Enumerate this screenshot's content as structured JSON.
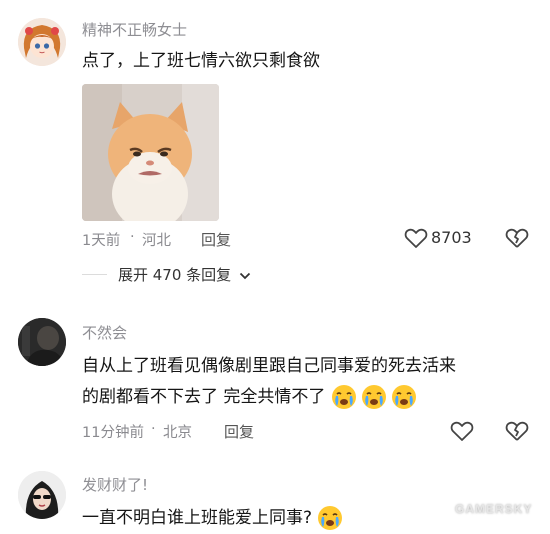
{
  "comments": [
    {
      "username": "精神不正畅女士",
      "text": "点了，上了班七情六欲只剩食欲",
      "time": "1天前",
      "location": "河北",
      "reply_label": "回复",
      "likes": "8703",
      "expand_label": "展开 470 条回复",
      "avatar_icon": "anime-girl-avatar",
      "image_icon": "sad-cat-meme"
    },
    {
      "username": "不然会",
      "text_line1": "自从上了班看见偶像剧里跟自己同事爱的死去活来",
      "text_line2": "的剧都看不下去了 完全共情不了",
      "time": "11分钟前",
      "location": "北京",
      "reply_label": "回复",
      "avatar_icon": "dark-photo-avatar",
      "emoji_icon": "crying-face-emoji"
    },
    {
      "username": "发财财了!",
      "text": "一直不明白谁上班能爱上同事?",
      "avatar_icon": "woman-sunglasses-avatar",
      "emoji_icon": "crying-face-emoji"
    }
  ],
  "watermark": "GAMERSKY",
  "colors": {
    "meta_gray": "#8a8a8f",
    "text": "#161616",
    "icon_stroke": "#444444"
  }
}
